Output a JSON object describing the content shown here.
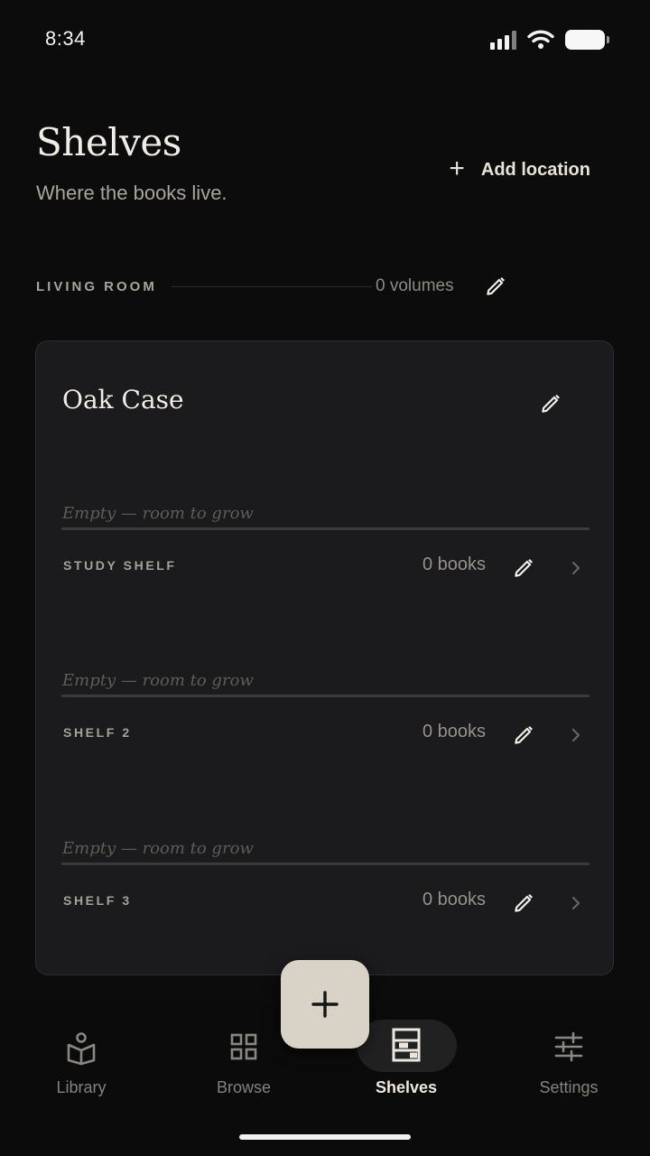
{
  "status_bar": {
    "time": "8:34"
  },
  "header": {
    "title": "Shelves",
    "subtitle": "Where the books live.",
    "add_location_label": "Add location"
  },
  "location": {
    "name": "LIVING ROOM",
    "volume_count": "0 volumes"
  },
  "case": {
    "title": "Oak Case",
    "shelves": [
      {
        "empty_text": "Empty — room to grow",
        "name": "STUDY SHELF",
        "count": "0 books"
      },
      {
        "empty_text": "Empty — room to grow",
        "name": "SHELF 2",
        "count": "0 books"
      },
      {
        "empty_text": "Empty — room to grow",
        "name": "SHELF 3",
        "count": "0 books"
      }
    ]
  },
  "nav": {
    "items": [
      {
        "label": "Library",
        "icon": "book-icon"
      },
      {
        "label": "Browse",
        "icon": "grid-icon"
      },
      {
        "label": "Shelves",
        "icon": "shelf-icon",
        "active": true
      },
      {
        "label": "Settings",
        "icon": "sliders-icon"
      }
    ]
  },
  "colors": {
    "background": "#0c0c0d",
    "card": "#1b1b1d",
    "accent": "#d9d2c6",
    "text": "#e8e4dc"
  },
  "icons": {
    "fab": "plus-icon",
    "edit": "pencil-icon",
    "row": "chevron-right-icon"
  }
}
